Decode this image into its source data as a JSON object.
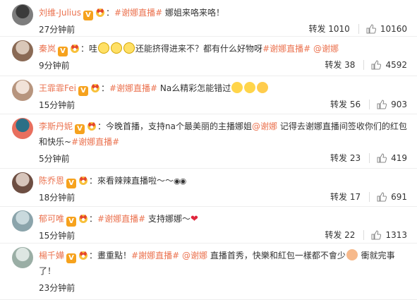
{
  "comments": [
    {
      "user": "刘维-Julius",
      "text_parts": [
        {
          "type": "topic",
          "text": "#谢娜直播#"
        },
        {
          "type": "text",
          "text": " 娜姐来咯来咯！"
        }
      ],
      "time": "27分钟前",
      "repost": "转发 1010",
      "likes": "10160"
    },
    {
      "user": "秦岚",
      "text_parts": [
        {
          "type": "text",
          "text": "哇"
        },
        {
          "type": "emoji",
          "name": "dizzy-emoji"
        },
        {
          "type": "emoji",
          "name": "dizzy-emoji"
        },
        {
          "type": "emoji",
          "name": "dizzy-emoji"
        },
        {
          "type": "text",
          "text": "还能挤得进来不？都有什么好物呀"
        },
        {
          "type": "topic",
          "text": "#谢娜直播#"
        },
        {
          "type": "text",
          "text": " "
        },
        {
          "type": "mention",
          "text": "@谢娜"
        }
      ],
      "time": "9分钟前",
      "repost": "转发 38",
      "likes": "4592"
    },
    {
      "user": "王霏霏Fei",
      "text_parts": [
        {
          "type": "topic",
          "text": "#谢娜直播#"
        },
        {
          "type": "text",
          "text": " Na么精彩怎能错过"
        },
        {
          "type": "emoji",
          "name": "smile-emoji"
        },
        {
          "type": "emoji",
          "name": "grin-emoji"
        },
        {
          "type": "emoji",
          "name": "blush-emoji"
        }
      ],
      "time": "15分钟前",
      "repost": "转发 56",
      "likes": "903"
    },
    {
      "user": "李斯丹妮",
      "text_parts": [
        {
          "type": "text",
          "text": "今晚首播，支持na个最美丽的主播娜姐"
        },
        {
          "type": "mention",
          "text": "@谢娜"
        },
        {
          "type": "text",
          "text": " 记得去谢娜直播间签收你们的红包和快乐~"
        },
        {
          "type": "topic",
          "text": "#谢娜直播#"
        }
      ],
      "time": "5分钟前",
      "repost": "转发 23",
      "likes": "419"
    },
    {
      "user": "陈乔恩",
      "text_parts": [
        {
          "type": "text",
          "text": "來看辣辣直播啦～～"
        },
        {
          "type": "emoji",
          "name": "eyes-emoji"
        }
      ],
      "time": "18分钟前",
      "repost": "转发 17",
      "likes": "691"
    },
    {
      "user": "郁可唯",
      "text_parts": [
        {
          "type": "topic",
          "text": "#谢娜直播#"
        },
        {
          "type": "text",
          "text": " 支持娜娜～"
        },
        {
          "type": "emoji",
          "name": "heart-emoji"
        }
      ],
      "time": "15分钟前",
      "repost": "转发 22",
      "likes": "1313"
    },
    {
      "user": "楊千嬅",
      "text_parts": [
        {
          "type": "text",
          "text": "畫重點！"
        },
        {
          "type": "topic",
          "text": "#謝娜直播#"
        },
        {
          "type": "text",
          "text": " "
        },
        {
          "type": "mention",
          "text": "@谢娜"
        },
        {
          "type": "text",
          "text": " 直播首秀，快樂和紅包一樣都不會少"
        },
        {
          "type": "emoji",
          "name": "muscle-emoji"
        },
        {
          "type": "text",
          "text": " 衝就完事了！"
        }
      ],
      "time": "23分钟前",
      "repost": "",
      "likes": ""
    }
  ],
  "colors": {
    "accent": "#eb7350",
    "badge": "#f6a21d",
    "text": "#333333"
  }
}
